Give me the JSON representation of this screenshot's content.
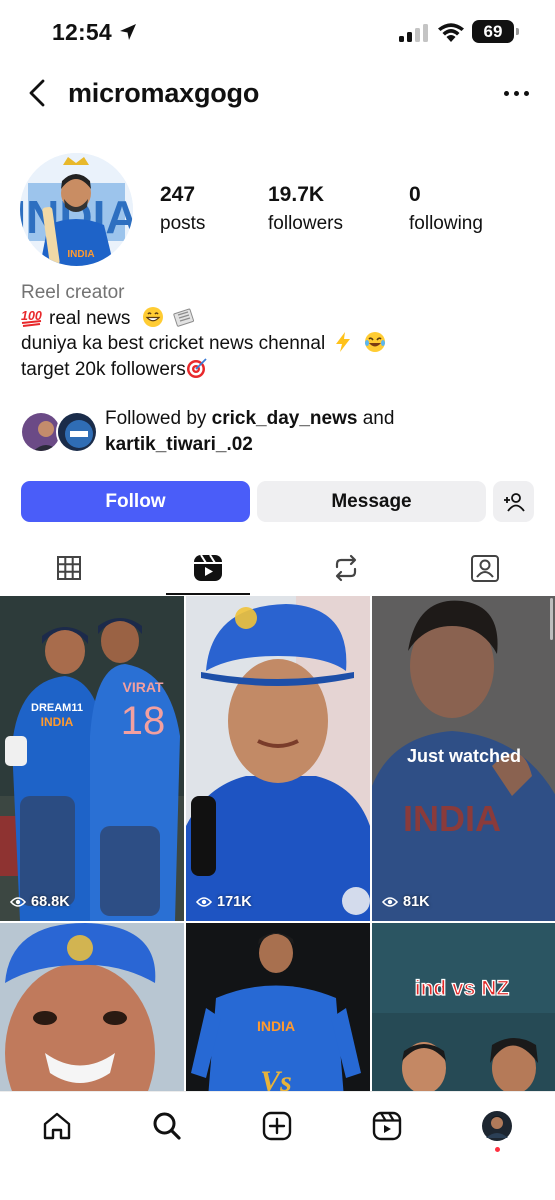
{
  "status_bar": {
    "time": "12:54",
    "battery": "69"
  },
  "header": {
    "username": "micromaxgogo"
  },
  "profile": {
    "stats": [
      {
        "value": "247",
        "label": "posts"
      },
      {
        "value": "19.7K",
        "label": "followers"
      },
      {
        "value": "0",
        "label": "following"
      }
    ],
    "category": "Reel creator",
    "bio_lines": [
      "real news",
      "duniya ka best cricket news chennal",
      "target 20k followers"
    ],
    "followed_by": {
      "prefix": "Followed by",
      "user1": "crick_day_news",
      "joiner": "and",
      "user2": "kartik_tiwari_.02"
    }
  },
  "actions": {
    "follow_label": "Follow",
    "message_label": "Message"
  },
  "tabs": [
    {
      "name": "posts",
      "icon": "grid-icon"
    },
    {
      "name": "reels",
      "icon": "reels-icon",
      "active": true
    },
    {
      "name": "reposts",
      "icon": "repost-icon"
    },
    {
      "name": "tagged",
      "icon": "tagged-icon"
    }
  ],
  "grid": [
    {
      "views": "68.8K"
    },
    {
      "views": "171K"
    },
    {
      "views": "81K",
      "overlay": "Just watched"
    },
    {
      "views": ""
    },
    {
      "views": ""
    },
    {
      "views": "",
      "title": "ind vs NZ"
    }
  ],
  "art_text": {
    "jersey_sponsor": "DREAM11",
    "jersey_team": "INDIA",
    "jersey_name": "VIRAT",
    "jersey_number": "18",
    "vs_text": "Vs"
  },
  "colors": {
    "follow_blue": "#4a5df9",
    "india_blue": "#1e63c8",
    "notification_red": "#ff3040"
  }
}
